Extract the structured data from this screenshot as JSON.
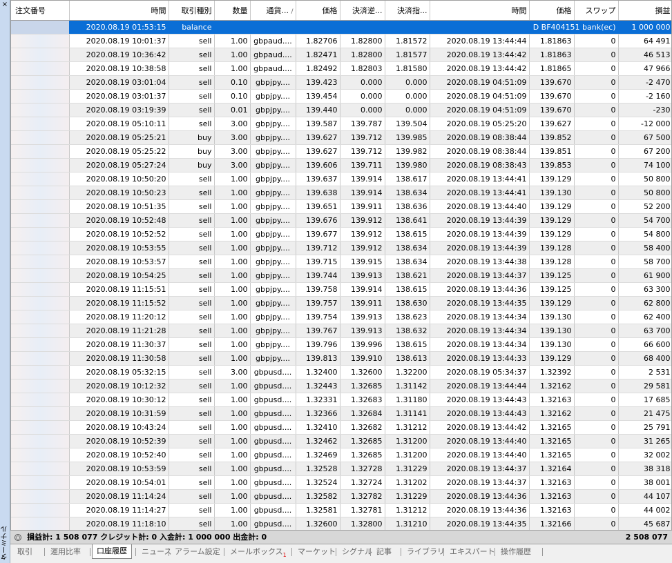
{
  "side": {
    "close": "×",
    "label": "ターミナル"
  },
  "columns": [
    "注文番号",
    "時間",
    "取引種別",
    "数量",
    "通貨...",
    "価格",
    "決済逆...",
    "決済指...",
    "時間",
    "価格",
    "スワップ",
    "損益"
  ],
  "sort_indicator": "/",
  "balance_row": {
    "time": "2020.08.19 01:53:15",
    "type": "balance",
    "comment": "D BF404151 bank(ec)",
    "profit": "1 000 000"
  },
  "rows": [
    [
      "2020.08.19 10:01:37",
      "sell",
      "1.00",
      "gbpaud....",
      "1.82706",
      "1.82800",
      "1.81572",
      "2020.08.19 13:44:44",
      "1.81863",
      "0",
      "64 491"
    ],
    [
      "2020.08.19 10:36:42",
      "sell",
      "1.00",
      "gbpaud....",
      "1.82471",
      "1.82800",
      "1.81577",
      "2020.08.19 13:44:42",
      "1.81863",
      "0",
      "46 513"
    ],
    [
      "2020.08.19 10:38:58",
      "sell",
      "1.00",
      "gbpaud....",
      "1.82492",
      "1.82803",
      "1.81580",
      "2020.08.19 13:44:42",
      "1.81865",
      "0",
      "47 966"
    ],
    [
      "2020.08.19 03:01:04",
      "sell",
      "0.10",
      "gbpjpy....",
      "139.423",
      "0.000",
      "0.000",
      "2020.08.19 04:51:09",
      "139.670",
      "0",
      "-2 470"
    ],
    [
      "2020.08.19 03:01:37",
      "sell",
      "0.10",
      "gbpjpy....",
      "139.454",
      "0.000",
      "0.000",
      "2020.08.19 04:51:09",
      "139.670",
      "0",
      "-2 160"
    ],
    [
      "2020.08.19 03:19:39",
      "sell",
      "0.01",
      "gbpjpy....",
      "139.440",
      "0.000",
      "0.000",
      "2020.08.19 04:51:09",
      "139.670",
      "0",
      "-230"
    ],
    [
      "2020.08.19 05:10:11",
      "sell",
      "3.00",
      "gbpjpy....",
      "139.587",
      "139.787",
      "139.504",
      "2020.08.19 05:25:20",
      "139.627",
      "0",
      "-12 000"
    ],
    [
      "2020.08.19 05:25:21",
      "buy",
      "3.00",
      "gbpjpy....",
      "139.627",
      "139.712",
      "139.985",
      "2020.08.19 08:38:44",
      "139.852",
      "0",
      "67 500"
    ],
    [
      "2020.08.19 05:25:22",
      "buy",
      "3.00",
      "gbpjpy....",
      "139.627",
      "139.712",
      "139.982",
      "2020.08.19 08:38:44",
      "139.851",
      "0",
      "67 200"
    ],
    [
      "2020.08.19 05:27:24",
      "buy",
      "3.00",
      "gbpjpy....",
      "139.606",
      "139.711",
      "139.980",
      "2020.08.19 08:38:43",
      "139.853",
      "0",
      "74 100"
    ],
    [
      "2020.08.19 10:50:20",
      "sell",
      "1.00",
      "gbpjpy....",
      "139.637",
      "139.914",
      "138.617",
      "2020.08.19 13:44:41",
      "139.129",
      "0",
      "50 800"
    ],
    [
      "2020.08.19 10:50:23",
      "sell",
      "1.00",
      "gbpjpy....",
      "139.638",
      "139.914",
      "138.634",
      "2020.08.19 13:44:41",
      "139.130",
      "0",
      "50 800"
    ],
    [
      "2020.08.19 10:51:35",
      "sell",
      "1.00",
      "gbpjpy....",
      "139.651",
      "139.911",
      "138.636",
      "2020.08.19 13:44:40",
      "139.129",
      "0",
      "52 200"
    ],
    [
      "2020.08.19 10:52:48",
      "sell",
      "1.00",
      "gbpjpy....",
      "139.676",
      "139.912",
      "138.641",
      "2020.08.19 13:44:39",
      "139.129",
      "0",
      "54 700"
    ],
    [
      "2020.08.19 10:52:52",
      "sell",
      "1.00",
      "gbpjpy....",
      "139.677",
      "139.912",
      "138.615",
      "2020.08.19 13:44:39",
      "139.129",
      "0",
      "54 800"
    ],
    [
      "2020.08.19 10:53:55",
      "sell",
      "1.00",
      "gbpjpy....",
      "139.712",
      "139.912",
      "138.634",
      "2020.08.19 13:44:39",
      "139.128",
      "0",
      "58 400"
    ],
    [
      "2020.08.19 10:53:57",
      "sell",
      "1.00",
      "gbpjpy....",
      "139.715",
      "139.915",
      "138.634",
      "2020.08.19 13:44:38",
      "139.128",
      "0",
      "58 700"
    ],
    [
      "2020.08.19 10:54:25",
      "sell",
      "1.00",
      "gbpjpy....",
      "139.744",
      "139.913",
      "138.621",
      "2020.08.19 13:44:37",
      "139.125",
      "0",
      "61 900"
    ],
    [
      "2020.08.19 11:15:51",
      "sell",
      "1.00",
      "gbpjpy....",
      "139.758",
      "139.914",
      "138.615",
      "2020.08.19 13:44:36",
      "139.125",
      "0",
      "63 300"
    ],
    [
      "2020.08.19 11:15:52",
      "sell",
      "1.00",
      "gbpjpy....",
      "139.757",
      "139.911",
      "138.630",
      "2020.08.19 13:44:35",
      "139.129",
      "0",
      "62 800"
    ],
    [
      "2020.08.19 11:20:12",
      "sell",
      "1.00",
      "gbpjpy....",
      "139.754",
      "139.913",
      "138.623",
      "2020.08.19 13:44:34",
      "139.130",
      "0",
      "62 400"
    ],
    [
      "2020.08.19 11:21:28",
      "sell",
      "1.00",
      "gbpjpy....",
      "139.767",
      "139.913",
      "138.632",
      "2020.08.19 13:44:34",
      "139.130",
      "0",
      "63 700"
    ],
    [
      "2020.08.19 11:30:37",
      "sell",
      "1.00",
      "gbpjpy....",
      "139.796",
      "139.996",
      "138.615",
      "2020.08.19 13:44:34",
      "139.130",
      "0",
      "66 600"
    ],
    [
      "2020.08.19 11:30:58",
      "sell",
      "1.00",
      "gbpjpy....",
      "139.813",
      "139.910",
      "138.613",
      "2020.08.19 13:44:33",
      "139.129",
      "0",
      "68 400"
    ],
    [
      "2020.08.19 05:32:15",
      "sell",
      "3.00",
      "gbpusd....",
      "1.32400",
      "1.32600",
      "1.32200",
      "2020.08.19 05:34:37",
      "1.32392",
      "0",
      "2 531"
    ],
    [
      "2020.08.19 10:12:32",
      "sell",
      "1.00",
      "gbpusd....",
      "1.32443",
      "1.32685",
      "1.31142",
      "2020.08.19 13:44:44",
      "1.32162",
      "0",
      "29 581"
    ],
    [
      "2020.08.19 10:30:12",
      "sell",
      "1.00",
      "gbpusd....",
      "1.32331",
      "1.32683",
      "1.31180",
      "2020.08.19 13:44:43",
      "1.32163",
      "0",
      "17 685"
    ],
    [
      "2020.08.19 10:31:59",
      "sell",
      "1.00",
      "gbpusd....",
      "1.32366",
      "1.32684",
      "1.31141",
      "2020.08.19 13:44:43",
      "1.32162",
      "0",
      "21 475"
    ],
    [
      "2020.08.19 10:43:24",
      "sell",
      "1.00",
      "gbpusd....",
      "1.32410",
      "1.32682",
      "1.31212",
      "2020.08.19 13:44:42",
      "1.32165",
      "0",
      "25 791"
    ],
    [
      "2020.08.19 10:52:39",
      "sell",
      "1.00",
      "gbpusd....",
      "1.32462",
      "1.32685",
      "1.31200",
      "2020.08.19 13:44:40",
      "1.32165",
      "0",
      "31 265"
    ],
    [
      "2020.08.19 10:52:40",
      "sell",
      "1.00",
      "gbpusd....",
      "1.32469",
      "1.32685",
      "1.31200",
      "2020.08.19 13:44:40",
      "1.32165",
      "0",
      "32 002"
    ],
    [
      "2020.08.19 10:53:59",
      "sell",
      "1.00",
      "gbpusd....",
      "1.32528",
      "1.32728",
      "1.31229",
      "2020.08.19 13:44:37",
      "1.32164",
      "0",
      "38 318"
    ],
    [
      "2020.08.19 10:54:01",
      "sell",
      "1.00",
      "gbpusd....",
      "1.32524",
      "1.32724",
      "1.31202",
      "2020.08.19 13:44:37",
      "1.32163",
      "0",
      "38 001"
    ],
    [
      "2020.08.19 11:14:24",
      "sell",
      "1.00",
      "gbpusd....",
      "1.32582",
      "1.32782",
      "1.31229",
      "2020.08.19 13:44:36",
      "1.32163",
      "0",
      "44 107"
    ],
    [
      "2020.08.19 11:14:27",
      "sell",
      "1.00",
      "gbpusd....",
      "1.32581",
      "1.32781",
      "1.31212",
      "2020.08.19 13:44:36",
      "1.32163",
      "0",
      "44 002"
    ],
    [
      "2020.08.19 11:18:10",
      "sell",
      "1.00",
      "gbpusd....",
      "1.32600",
      "1.32800",
      "1.31210",
      "2020.08.19 13:44:35",
      "1.32166",
      "0",
      "45 687"
    ]
  ],
  "summary": {
    "text": "損益計: 1 508 077  クレジット計: 0  入金計: 1 000 000  出金計: 0",
    "total": "2 508 077"
  },
  "tabs": [
    "取引",
    "運用比率",
    "口座履歴",
    "ニュース",
    "アラーム設定",
    "メールボックス",
    "マーケット",
    "シグナル",
    "記事",
    "ライブラリ",
    "エキスパート",
    "操作履歴"
  ],
  "active_tab": "口座履歴",
  "mailbox_badge": "1",
  "colors": {
    "selection": "#0a6ed6",
    "row_alt": "#eeeeee",
    "summary_bg": "#d7d7d7"
  }
}
